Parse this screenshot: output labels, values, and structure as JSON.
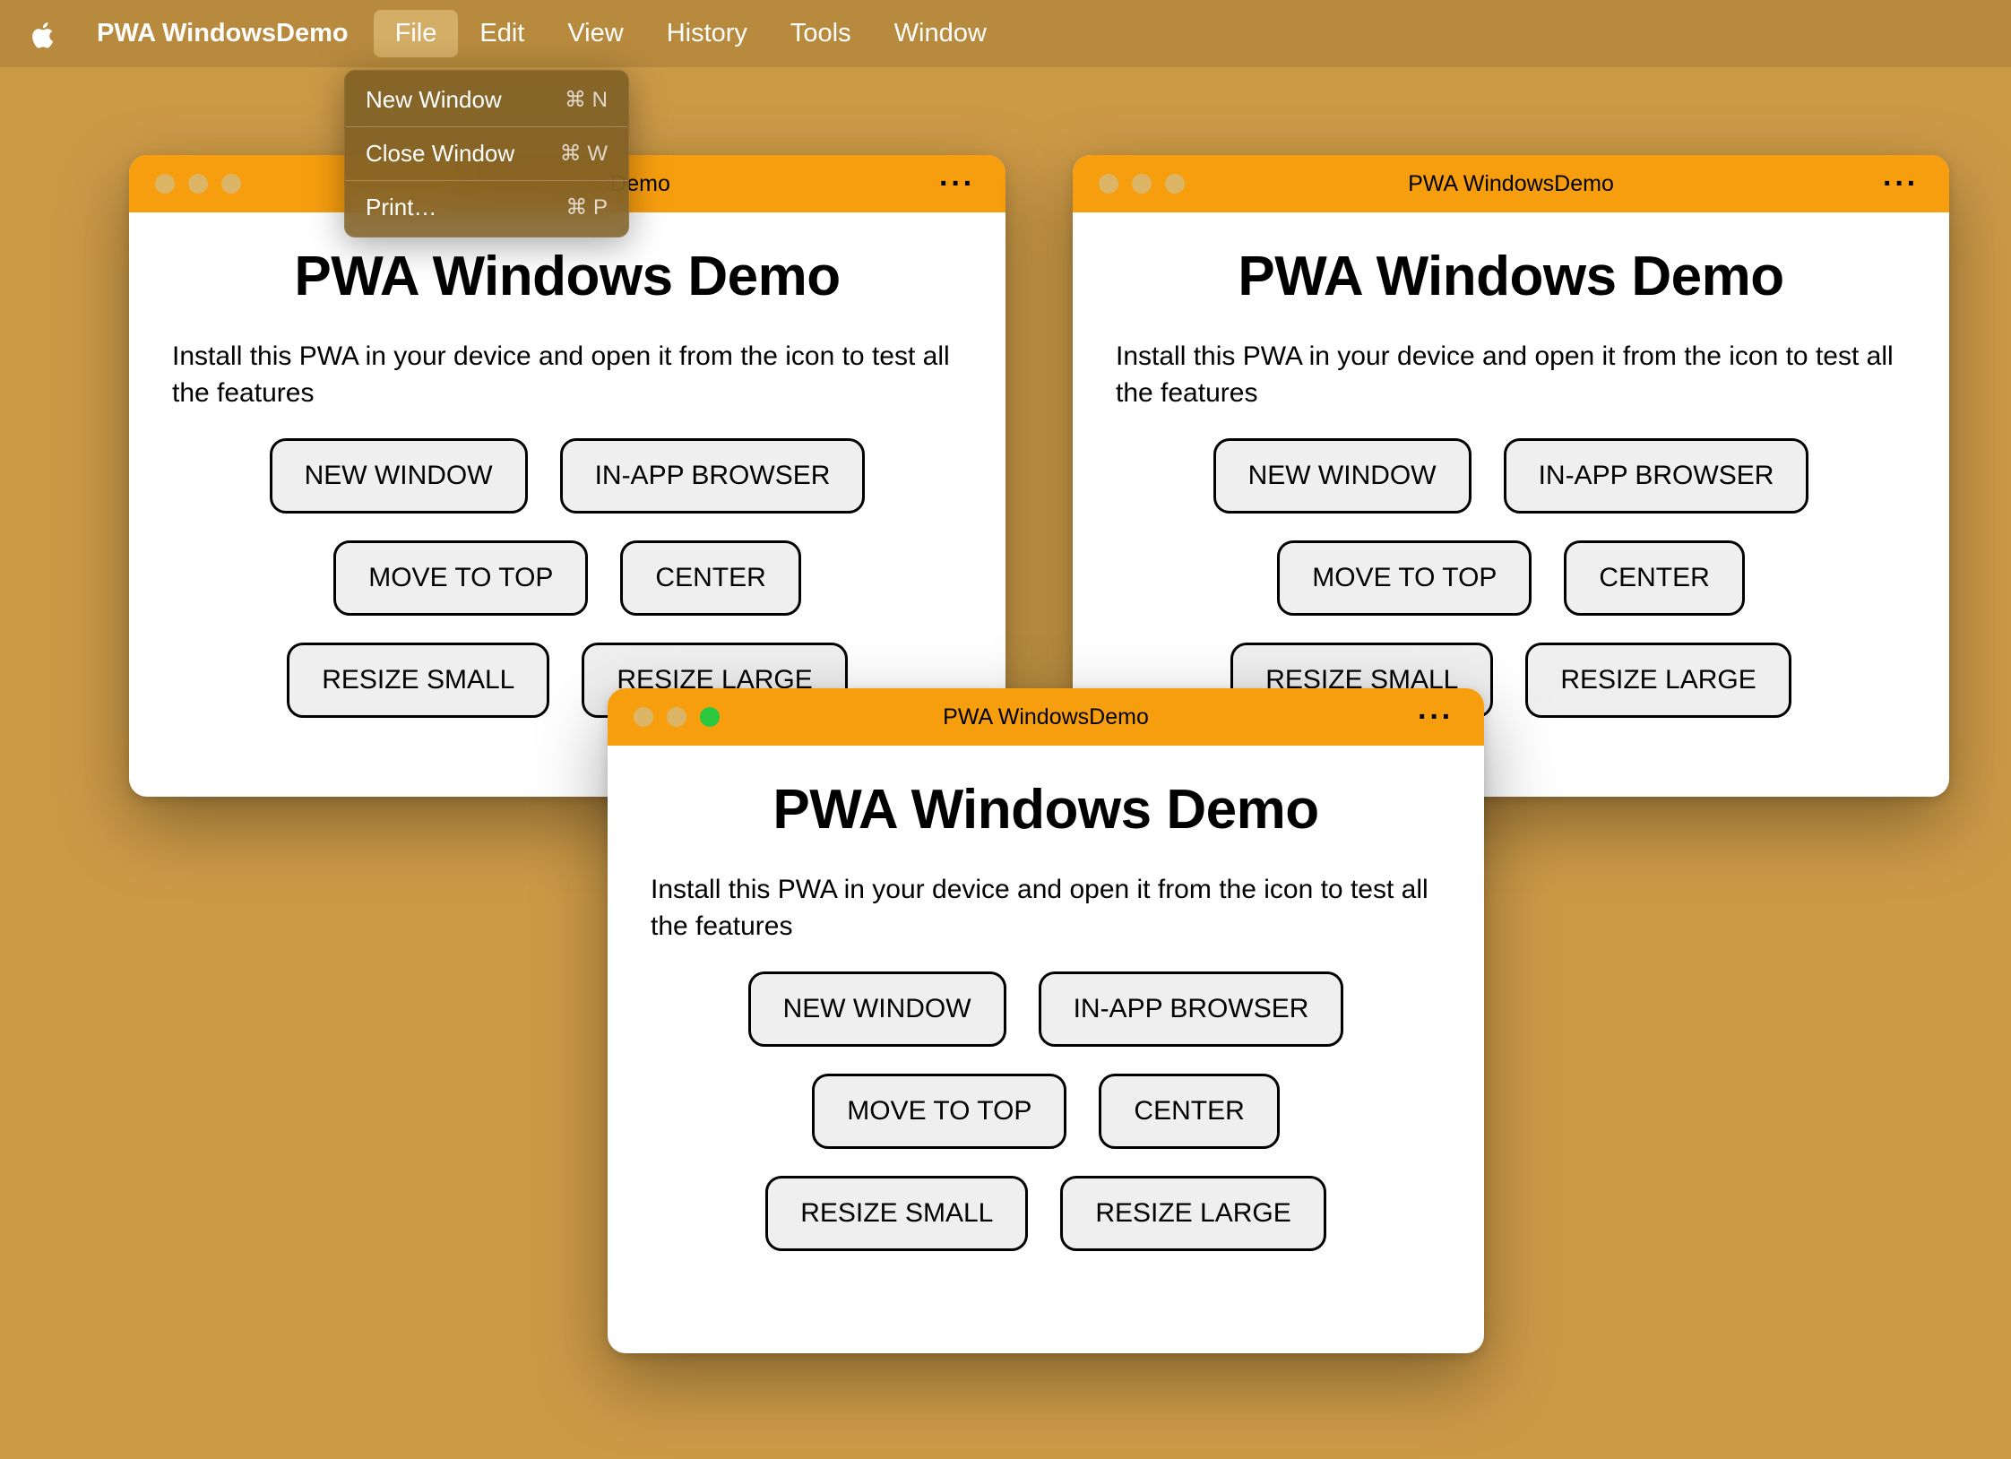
{
  "menubar": {
    "app_name": "PWA WindowsDemo",
    "items": [
      "File",
      "Edit",
      "View",
      "History",
      "Tools",
      "Window"
    ],
    "active_index": 0
  },
  "dropdown": {
    "items": [
      {
        "label": "New Window",
        "shortcut": "⌘ N"
      },
      {
        "label": "Close Window",
        "shortcut": "⌘ W"
      },
      {
        "label": "Print…",
        "shortcut": "⌘ P"
      }
    ]
  },
  "app": {
    "window_title": "PWA WindowsDemo",
    "page_title": "PWA Windows Demo",
    "description": "Install this PWA in your device and open it from the icon to test all the features",
    "buttons": {
      "new_window": "NEW WINDOW",
      "in_app_browser": "IN-APP BROWSER",
      "move_to_top": "MOVE TO TOP",
      "center": "CENTER",
      "resize_small": "RESIZE SMALL",
      "resize_large": "RESIZE LARGE"
    },
    "more_glyph": "···"
  },
  "colors": {
    "desktop": "#cc9a47",
    "menubar": "#b78a3e",
    "titlebar": "#f79e0f"
  }
}
